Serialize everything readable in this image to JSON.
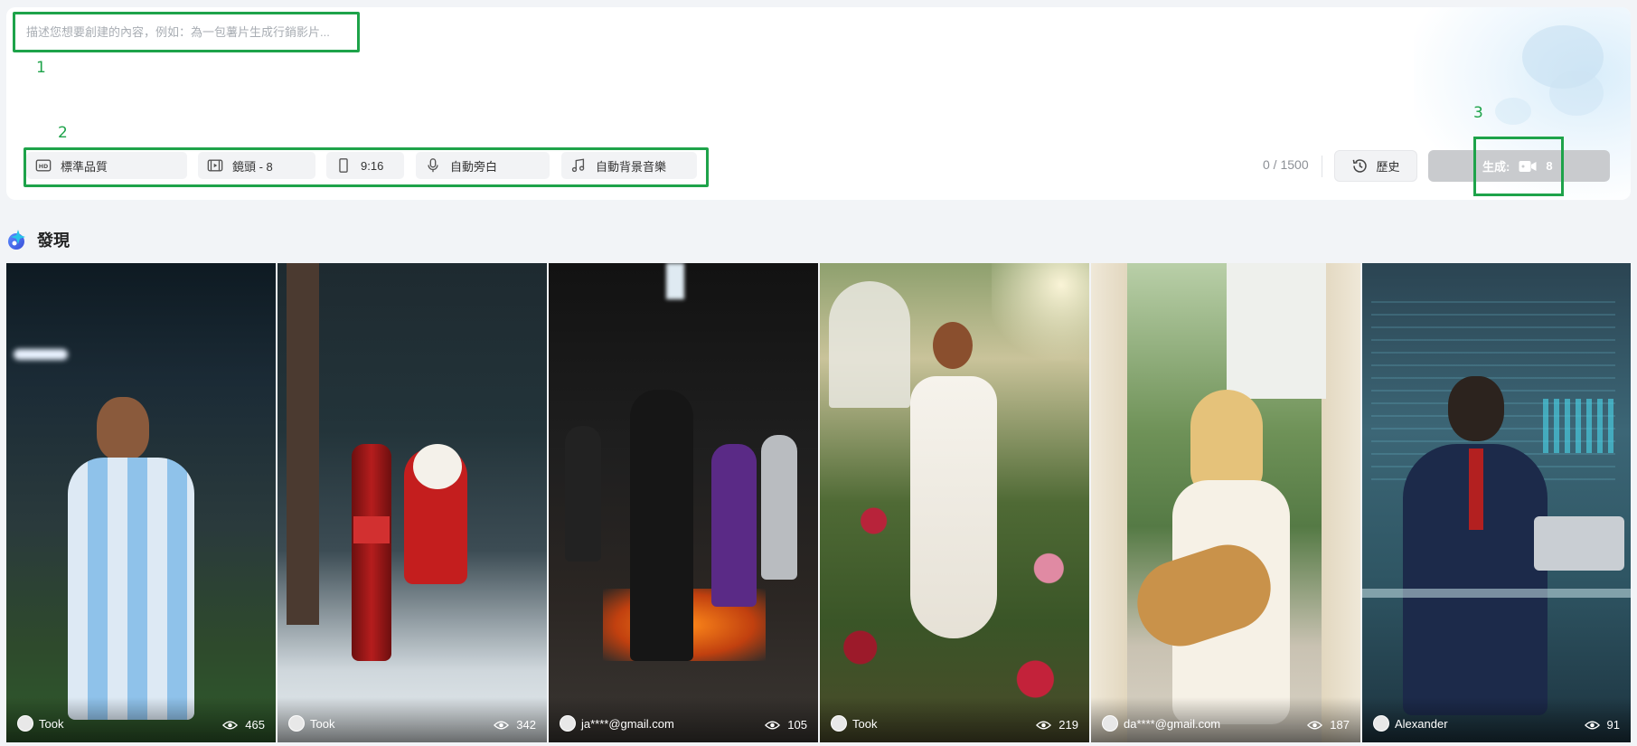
{
  "prompt": {
    "placeholder": "描述您想要創建的內容，例如：為一包薯片生成行銷影片..."
  },
  "markers": {
    "one": "1",
    "two": "2",
    "three": "3"
  },
  "options": [
    {
      "label": "標準品質",
      "icon": "hd-icon"
    },
    {
      "label": "鏡頭 - 8",
      "icon": "film-icon"
    },
    {
      "label": "9:16",
      "icon": "phone-portrait-icon"
    },
    {
      "label": "自動旁白",
      "icon": "microphone-icon"
    },
    {
      "label": "自動背景音樂",
      "icon": "music-note-icon"
    }
  ],
  "char_count": "0 / 1500",
  "history_label": "歷史",
  "generate": {
    "label": "生成:",
    "cost": "8",
    "icon": "video-camera-icon"
  },
  "discover": {
    "title": "發現",
    "icon": "discover-logo-icon"
  },
  "cards": [
    {
      "user": "Took",
      "views": "465"
    },
    {
      "user": "Took",
      "views": "342"
    },
    {
      "user": "ja****@gmail.com",
      "views": "105"
    },
    {
      "user": "Took",
      "views": "219"
    },
    {
      "user": "da****@gmail.com",
      "views": "187"
    },
    {
      "user": "Alexander",
      "views": "91"
    }
  ],
  "colors": {
    "highlight_box": "#1ea34a",
    "generate_disabled": "#c9cbce",
    "panel_bg": "#ffffff",
    "page_bg": "#f2f4f7"
  }
}
